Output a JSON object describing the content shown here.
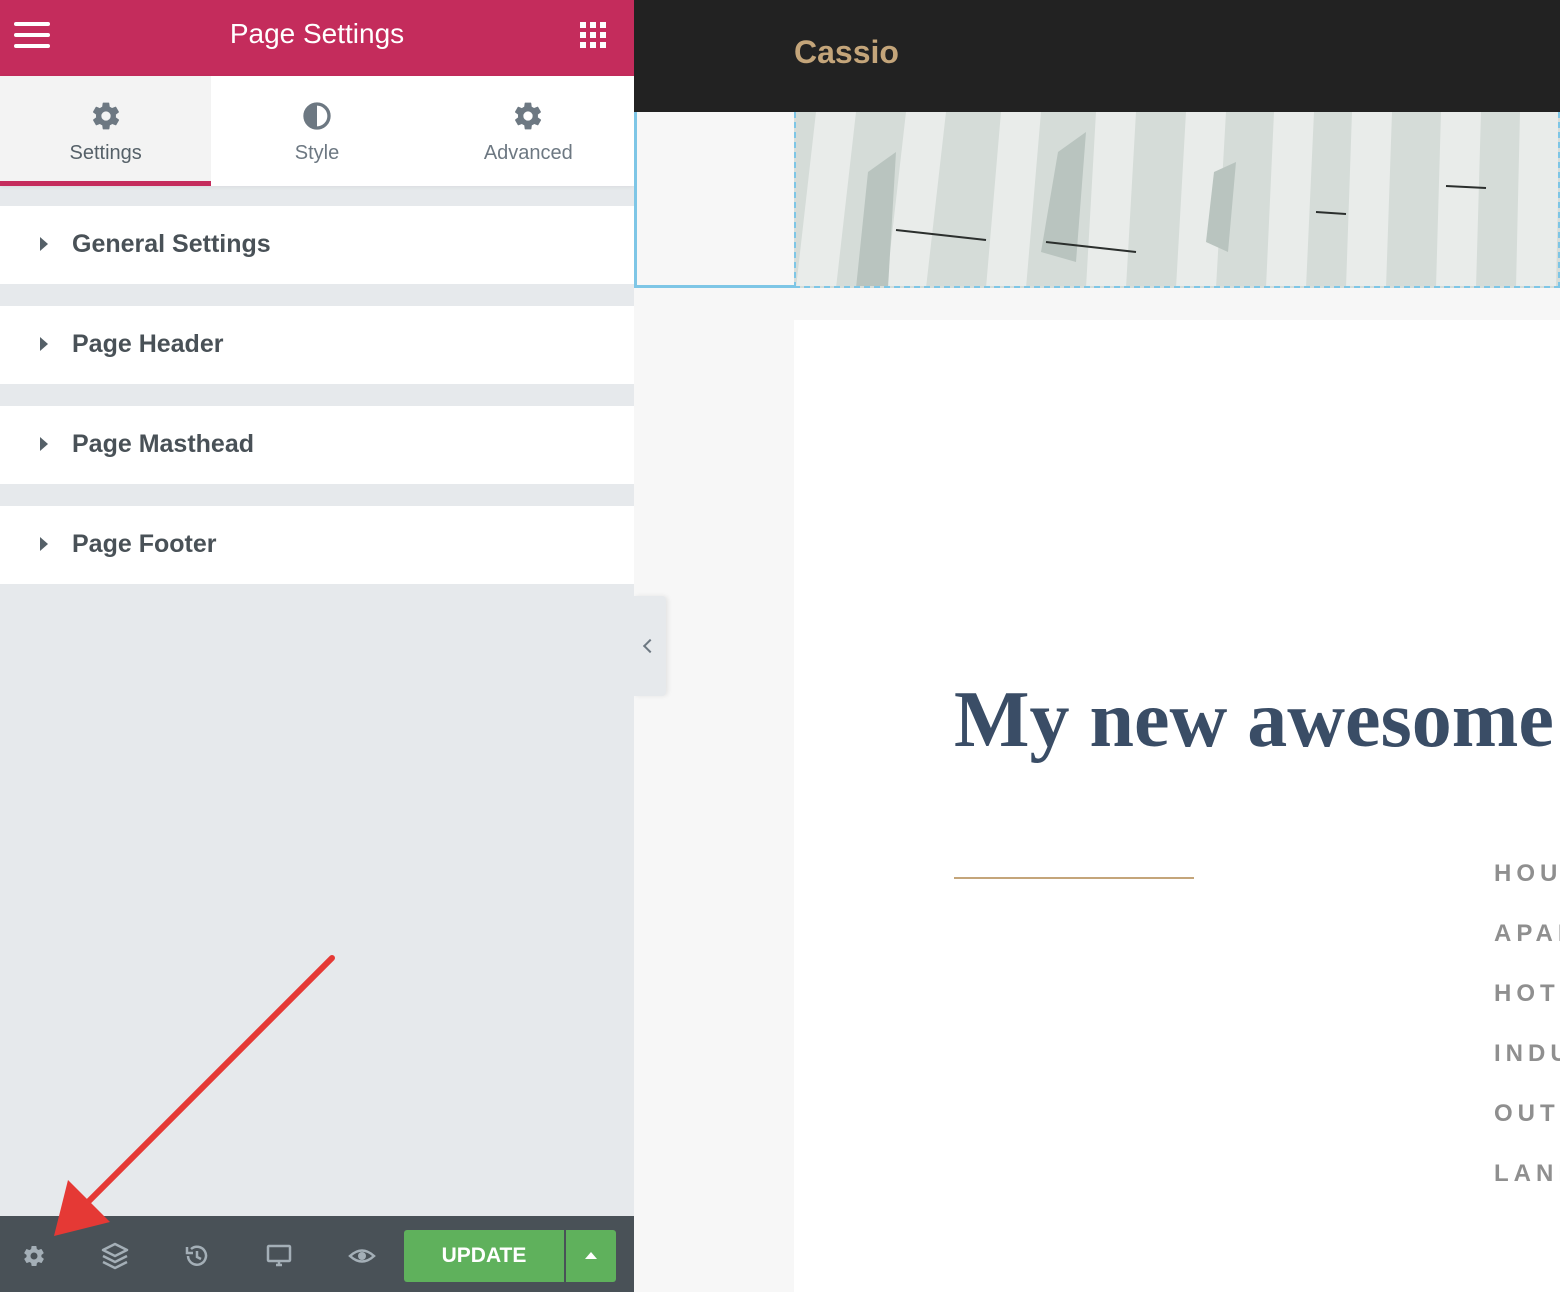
{
  "panel": {
    "title": "Page Settings",
    "tabs": [
      {
        "label": "Settings",
        "icon": "gear-icon",
        "active": true
      },
      {
        "label": "Style",
        "icon": "contrast-icon",
        "active": false
      },
      {
        "label": "Advanced",
        "icon": "gear-icon",
        "active": false
      }
    ],
    "sections": [
      {
        "title": "General Settings"
      },
      {
        "title": "Page Header"
      },
      {
        "title": "Page Masthead"
      },
      {
        "title": "Page Footer"
      }
    ],
    "footer": {
      "icons": [
        "gear-icon",
        "layers-icon",
        "history-icon",
        "desktop-icon",
        "eye-icon"
      ],
      "update_label": "UPDATE"
    },
    "accent_color": "#c42c5c",
    "update_color": "#5fb15c"
  },
  "preview": {
    "site_title": "Cassio",
    "heading": "My new awesome",
    "categories": [
      "HOUS",
      "APAI",
      "HOTI",
      "INDU",
      "OUTD",
      "LAND"
    ],
    "gold_color": "#c4a57a",
    "heading_color": "#3a4d66"
  }
}
